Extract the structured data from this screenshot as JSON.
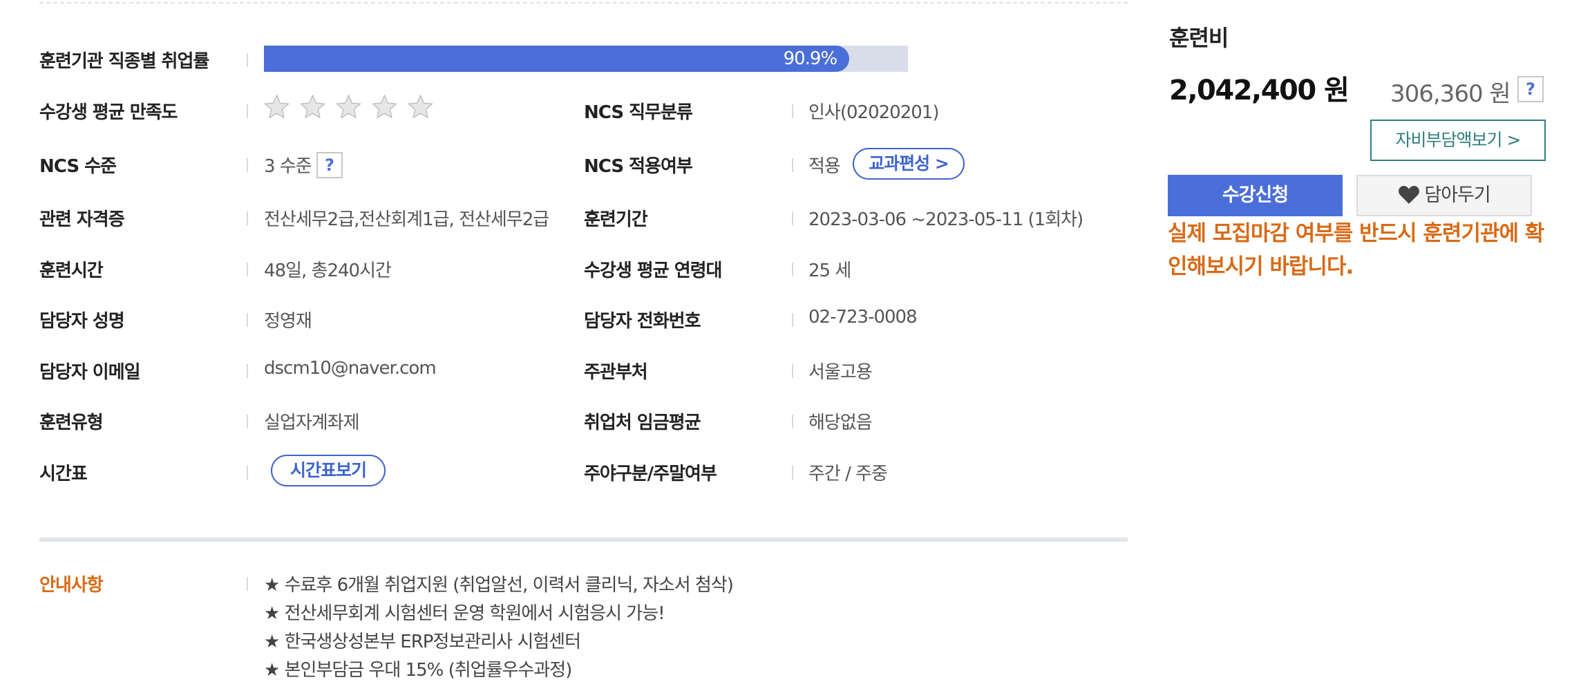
{
  "details": {
    "employment_rate": {
      "label": "훈련기관 직종별 취업률",
      "value_text": "90.9%",
      "value": 90.9
    },
    "satisfaction": {
      "label": "수강생 평균 만족도",
      "stars_filled": 0,
      "stars_total": 5
    },
    "ncs_category": {
      "label": "NCS 직무분류",
      "value": "인사(02020201)"
    },
    "ncs_level": {
      "label": "NCS 수준",
      "value": "3 수준",
      "help": "?"
    },
    "ncs_applied": {
      "label": "NCS 적용여부",
      "value": "적용",
      "button": "교과편성 >"
    },
    "certificates": {
      "label": "관련 자격증",
      "value": "전산세무2급,전산회계1급, 전산세무2급"
    },
    "period": {
      "label": "훈련기간",
      "value": "2023-03-06 ~2023-05-11 (1회차)"
    },
    "hours": {
      "label": "훈련시간",
      "value": "48일, 총240시간"
    },
    "avg_age": {
      "label": "수강생 평균 연령대",
      "value": "25 세"
    },
    "manager_name": {
      "label": "담당자 성명",
      "value": "정영재"
    },
    "manager_phone": {
      "label": "담당자 전화번호",
      "value": "02-723-0008"
    },
    "manager_email": {
      "label": "담당자 이메일",
      "value": "dscm10@naver.com"
    },
    "authority": {
      "label": "주관부처",
      "value": "서울고용"
    },
    "training_type": {
      "label": "훈련유형",
      "value": "실업자계좌제"
    },
    "wage_avg": {
      "label": "취업처 임금평균",
      "value": "해당없음"
    },
    "timetable": {
      "label": "시간표",
      "button": "시간표보기"
    },
    "day_type": {
      "label": "주야구분/주말여부",
      "value": "주간 / 주중"
    }
  },
  "notice": {
    "label": "안내사항",
    "lines": [
      "★ 수료후 6개월 취업지원 (취업알선, 이력서 클리닉, 자소서 첨삭)",
      "★ 전산세무회계 시험센터 운영 학원에서 시험응시 가능!",
      "★ 한국생상성본부 ERP정보관리사 시험센터",
      "★ 본인부담금 우대 15% (취업률우수과정)"
    ]
  },
  "fee": {
    "title": "훈련비",
    "total": "2,042,400 원",
    "self_pay": "306,360 원",
    "help": "?",
    "self_pay_button": "자비부담액보기 >",
    "apply_button": "수강신청",
    "wish_button": "담아두기",
    "warning": "실제 모집마감 여부를 반드시 훈련기관에 확인해보시기 바랍니다."
  },
  "colors": {
    "accent": "#4b6fd8",
    "warning": "#d86a16",
    "teal": "#2f7d7d"
  }
}
